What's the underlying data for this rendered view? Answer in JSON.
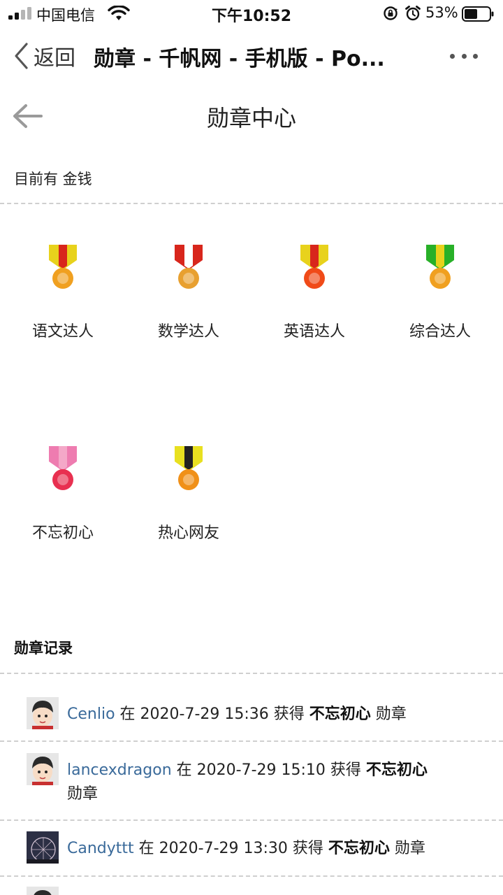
{
  "status_bar": {
    "carrier": "中国电信",
    "time": "下午10:52",
    "battery": "53%"
  },
  "nav": {
    "back_label": "返回",
    "title": "勋章 - 千帆网 - 手机版 - Po..."
  },
  "header": {
    "title": "勋章中心"
  },
  "money": {
    "text": "目前有 金钱"
  },
  "medals": [
    {
      "label": "语文达人",
      "ribbon": [
        "#e8d21c",
        "#d8261c"
      ],
      "disk": "#f0a020"
    },
    {
      "label": "数学达人",
      "ribbon": [
        "#d8261c",
        "#ffffff"
      ],
      "disk": "#e8a030"
    },
    {
      "label": "英语达人",
      "ribbon": [
        "#e8d21c",
        "#d8261c"
      ],
      "disk": "#f04a18"
    },
    {
      "label": "综合达人",
      "ribbon": [
        "#28b028",
        "#e8d21c"
      ],
      "disk": "#f0a020"
    },
    {
      "label": "不忘初心",
      "ribbon": [
        "#ee7cb0",
        "#f4a8c8"
      ],
      "disk": "#e83050"
    },
    {
      "label": "热心网友",
      "ribbon": [
        "#e8e020",
        "#222222"
      ],
      "disk": "#f09018"
    }
  ],
  "records": {
    "title": "勋章记录",
    "items": [
      {
        "user": "Cenlio",
        "t1": "在 2020-7-29 15:36 获得",
        "medal": "不忘初心",
        "t2": "勋章"
      },
      {
        "user": "lancexdragon",
        "t1": "在 2020-7-29 15:10 获得",
        "medal": "不忘初心",
        "t2": "勋章"
      },
      {
        "user": "Candyttt",
        "t1": "在 2020-7-29 13:30 获得",
        "medal": "不忘初心",
        "t2": "勋章"
      }
    ]
  }
}
